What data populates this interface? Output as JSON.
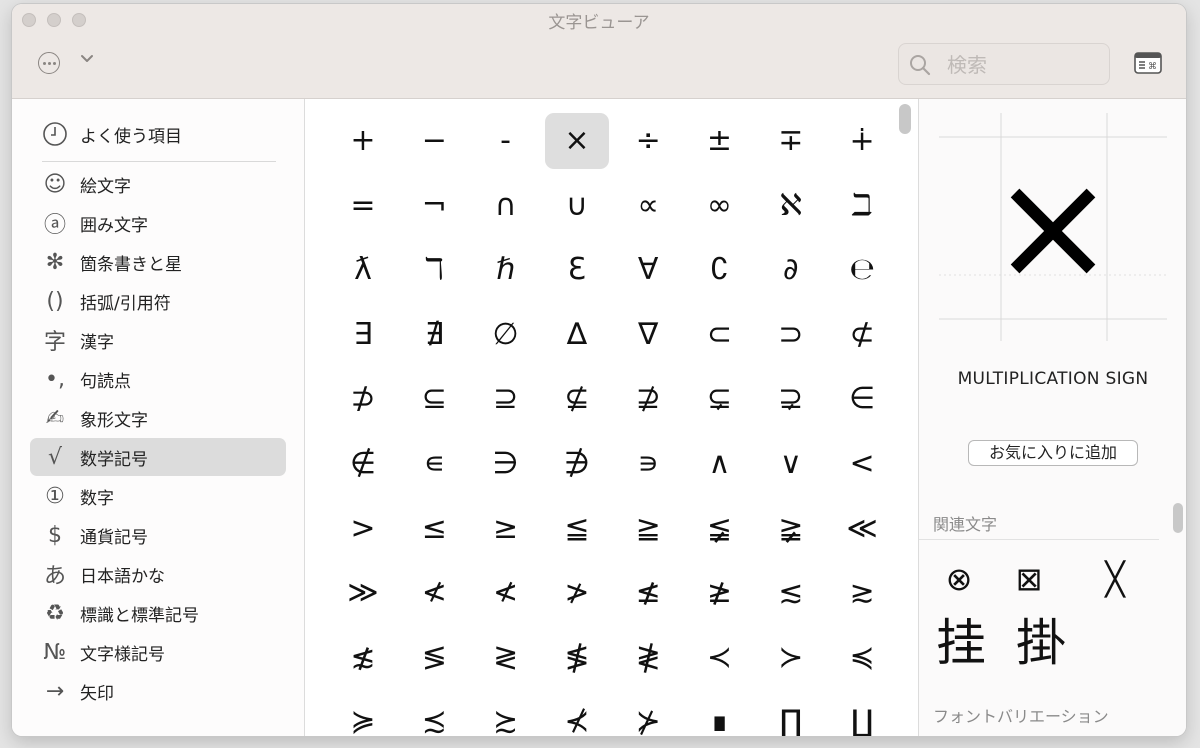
{
  "window": {
    "title": "文字ビューア"
  },
  "toolbar": {
    "search_placeholder": "検索"
  },
  "sidebar": {
    "favorites": {
      "label": "よく使う項目",
      "icon": "clock-icon"
    },
    "items": [
      {
        "label": "絵文字",
        "icon": "smiley-icon",
        "glyph": "☺"
      },
      {
        "label": "囲み文字",
        "icon": "circled-a-icon",
        "glyph": "ⓐ"
      },
      {
        "label": "箇条書きと星",
        "icon": "asterisk-icon",
        "glyph": "✻"
      },
      {
        "label": "括弧/引用符",
        "icon": "parentheses-icon",
        "glyph": "()"
      },
      {
        "label": "漢字",
        "icon": "kanji-icon",
        "glyph": "字"
      },
      {
        "label": "句読点",
        "icon": "punctuation-icon",
        "glyph": "•,"
      },
      {
        "label": "象形文字",
        "icon": "pictograph-icon",
        "glyph": "✍"
      },
      {
        "label": "数学記号",
        "icon": "square-root-icon",
        "glyph": "√",
        "selected": true
      },
      {
        "label": "数字",
        "icon": "circled-one-icon",
        "glyph": "①"
      },
      {
        "label": "通貨記号",
        "icon": "dollar-icon",
        "glyph": "$"
      },
      {
        "label": "日本語かな",
        "icon": "hiragana-icon",
        "glyph": "あ"
      },
      {
        "label": "標識と標準記号",
        "icon": "recycle-icon",
        "glyph": "♻"
      },
      {
        "label": "文字様記号",
        "icon": "numero-icon",
        "glyph": "№"
      },
      {
        "label": "矢印",
        "icon": "arrow-icon",
        "glyph": "→"
      }
    ]
  },
  "grid": {
    "selected_index": 3,
    "chars": [
      "+",
      "−",
      "-",
      "×",
      "÷",
      "±",
      "∓",
      "∔",
      "=",
      "¬",
      "∩",
      "∪",
      "∝",
      "∞",
      "ℵ",
      "ℶ",
      "ƛ",
      "ℸ",
      "ℏ",
      "Ɛ",
      "∀",
      "∁",
      "∂",
      "℮",
      "∃",
      "∄",
      "∅",
      "∆",
      "∇",
      "⊂",
      "⊃",
      "⊄",
      "⊅",
      "⊆",
      "⊇",
      "⊈",
      "⊉",
      "⊊",
      "⊋",
      "∈",
      "∉",
      "∊",
      "∋",
      "∌",
      "∍",
      "∧",
      "∨",
      "<",
      ">",
      "≤",
      "≥",
      "≦",
      "≧",
      "≨",
      "≩",
      "≪",
      "≫",
      "≮",
      "≮",
      "≯",
      "≰",
      "≱",
      "≲",
      "≳",
      "≴",
      "≶",
      "≷",
      "≸",
      "≹",
      "≺",
      "≻",
      "≼",
      "≽",
      "≾",
      "≿",
      "⊀",
      "⊁",
      "∎",
      "∏",
      "∐"
    ]
  },
  "detail": {
    "preview_char": "×",
    "name": "MULTIPLICATION SIGN",
    "add_favorite_label": "お気に入りに追加",
    "related_header": "関連文字",
    "related": [
      "⊗",
      "⊠",
      "╳",
      "挂",
      "掛"
    ],
    "variation_header": "フォントバリエーション"
  }
}
